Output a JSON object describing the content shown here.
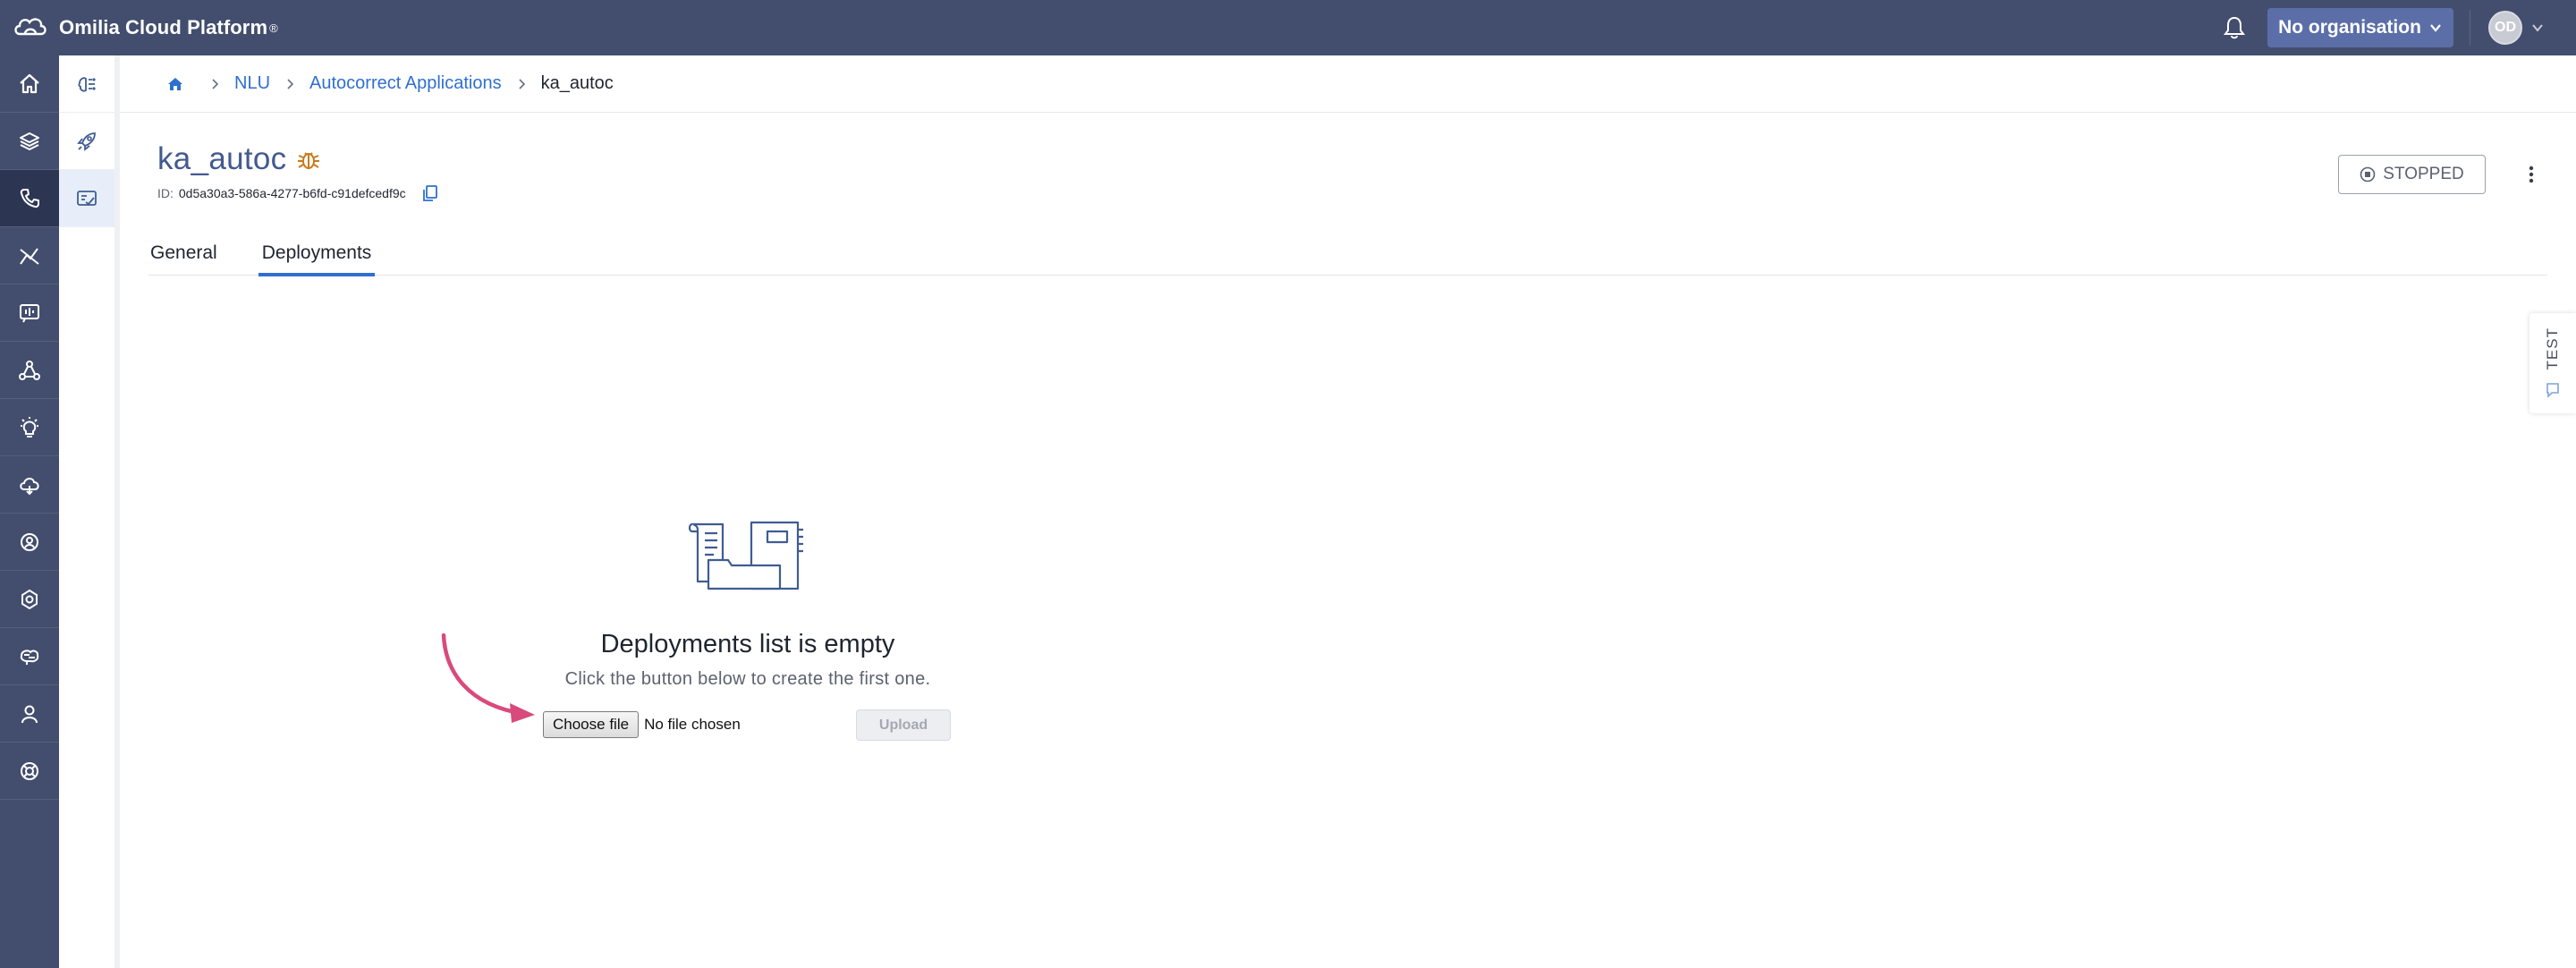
{
  "app": {
    "name": "Omilia Cloud Platform",
    "reg_mark": "®",
    "organisation": "No organisation",
    "avatar_initials": "OD"
  },
  "colors": {
    "topbar": "#434e6e",
    "nav_active": "#2c3552",
    "accent": "#2f6fd0",
    "title": "#435a8f",
    "org_button": "#5b6ea8",
    "annotation_arrow": "#d94a7c"
  },
  "leftnav": {
    "items": [
      {
        "icon": "home-icon"
      },
      {
        "icon": "layers-icon"
      },
      {
        "icon": "phone-touch-icon",
        "active": true
      },
      {
        "icon": "analytics-icon"
      },
      {
        "icon": "voice-report-icon"
      },
      {
        "icon": "network-icon"
      },
      {
        "icon": "lightbulb-icon"
      },
      {
        "icon": "cloud-icon"
      },
      {
        "icon": "user-settings-icon"
      },
      {
        "icon": "cog-icon"
      },
      {
        "icon": "brain-icon"
      },
      {
        "icon": "user-icon"
      },
      {
        "icon": "lifebuoy-icon"
      }
    ]
  },
  "subnav": {
    "items": [
      {
        "icon": "ai-brain-icon"
      },
      {
        "icon": "rocket-icon"
      },
      {
        "icon": "spellcheck-icon",
        "active": true
      }
    ]
  },
  "breadcrumb": {
    "items": [
      "NLU",
      "Autocorrect Applications"
    ],
    "current": "ka_autoc"
  },
  "header": {
    "title": "ka_autoc",
    "id_label": "ID:",
    "id_value": "0d5a30a3-586a-4277-b6fd-c91defcedf9c",
    "status": "STOPPED"
  },
  "tabs": [
    {
      "label": "General",
      "active": false
    },
    {
      "label": "Deployments",
      "active": true
    }
  ],
  "side_tab": {
    "label": "TEST"
  },
  "empty_state": {
    "title": "Deployments list is empty",
    "subtitle": "Click the button below to create the first one.",
    "choose_file": "Choose file",
    "no_file": "No file chosen",
    "upload": "Upload"
  }
}
